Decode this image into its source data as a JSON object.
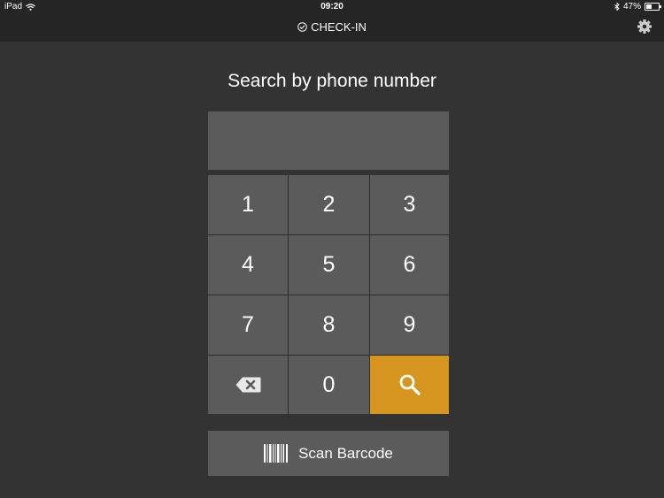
{
  "status_bar": {
    "device": "iPad",
    "time": "09:20",
    "battery": "47%",
    "battery_level": 0.47,
    "icons": [
      "wifi-icon",
      "bluetooth-icon",
      "battery-icon"
    ]
  },
  "nav": {
    "title": "CHECK-IN",
    "title_icon": "check-circle-icon",
    "settings_icon": "gear-icon"
  },
  "main": {
    "heading": "Search by phone number",
    "phone_value": ""
  },
  "keypad": {
    "keys": [
      "1",
      "2",
      "3",
      "4",
      "5",
      "6",
      "7",
      "8",
      "9"
    ],
    "zero": "0",
    "backspace_icon": "backspace-icon",
    "search_icon": "search-icon"
  },
  "scan": {
    "label": "Scan Barcode",
    "icon": "barcode-icon"
  },
  "colors": {
    "background": "#333333",
    "bar": "#252525",
    "key": "#5b5b5b",
    "accent": "#d6951e",
    "text": "#ffffff"
  }
}
